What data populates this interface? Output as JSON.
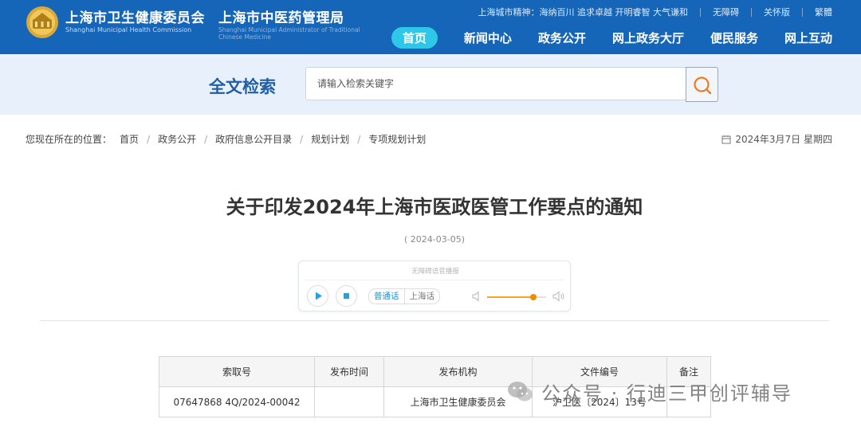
{
  "header": {
    "org1_name": "上海市卫生健康委员会",
    "org1_name_en": "Shanghai Municipal Health Commission",
    "org2_name": "上海市中医药管理局",
    "org2_name_en": "Shanghai Municipal Administrator of Traditional Chinese Medicine",
    "city_spirit": "上海城市精神：海纳百川 追求卓越 开明睿智 大气谦和",
    "accessibility_link": "无障碍",
    "elder_mode_link": "关怀版",
    "traditional_link": "繁體",
    "brand_color": "#1565b8",
    "nav": [
      {
        "label": "首页",
        "active": true
      },
      {
        "label": "新闻中心"
      },
      {
        "label": "政务公开"
      },
      {
        "label": "网上政务大厅"
      },
      {
        "label": "便民服务"
      },
      {
        "label": "网上互动"
      }
    ]
  },
  "search": {
    "title": "全文检索",
    "placeholder": "请输入检索关键字",
    "button_icon": "search-icon"
  },
  "breadcrumb": {
    "prefix": "您现在所在的位置：",
    "items": [
      "首页",
      "政务公开",
      "政府信息公开目录",
      "规划计划",
      "专项规划计划"
    ]
  },
  "date_display": "2024年3月7日 星期四",
  "article": {
    "title": "关于印发2024年上海市医政医管工作要点的通知",
    "publish_date": "( 2024-03-05)"
  },
  "player": {
    "label": "无障碍语音播报",
    "dialects": [
      "普通话",
      "上海话"
    ],
    "selected_dialect": "普通话",
    "volume": 0.78
  },
  "meta_table": {
    "headers": [
      "索取号",
      "发布时间",
      "发布机构",
      "文件编号",
      "备注"
    ],
    "rows": [
      [
        "07647868 4Q/2024-00042",
        "",
        "上海市卫生健康委员会",
        "沪卫医〔2024〕13号",
        ""
      ]
    ]
  },
  "watermark": {
    "text": "公众号 · 行迪三甲创评辅导",
    "icon": "wechat-icon"
  }
}
